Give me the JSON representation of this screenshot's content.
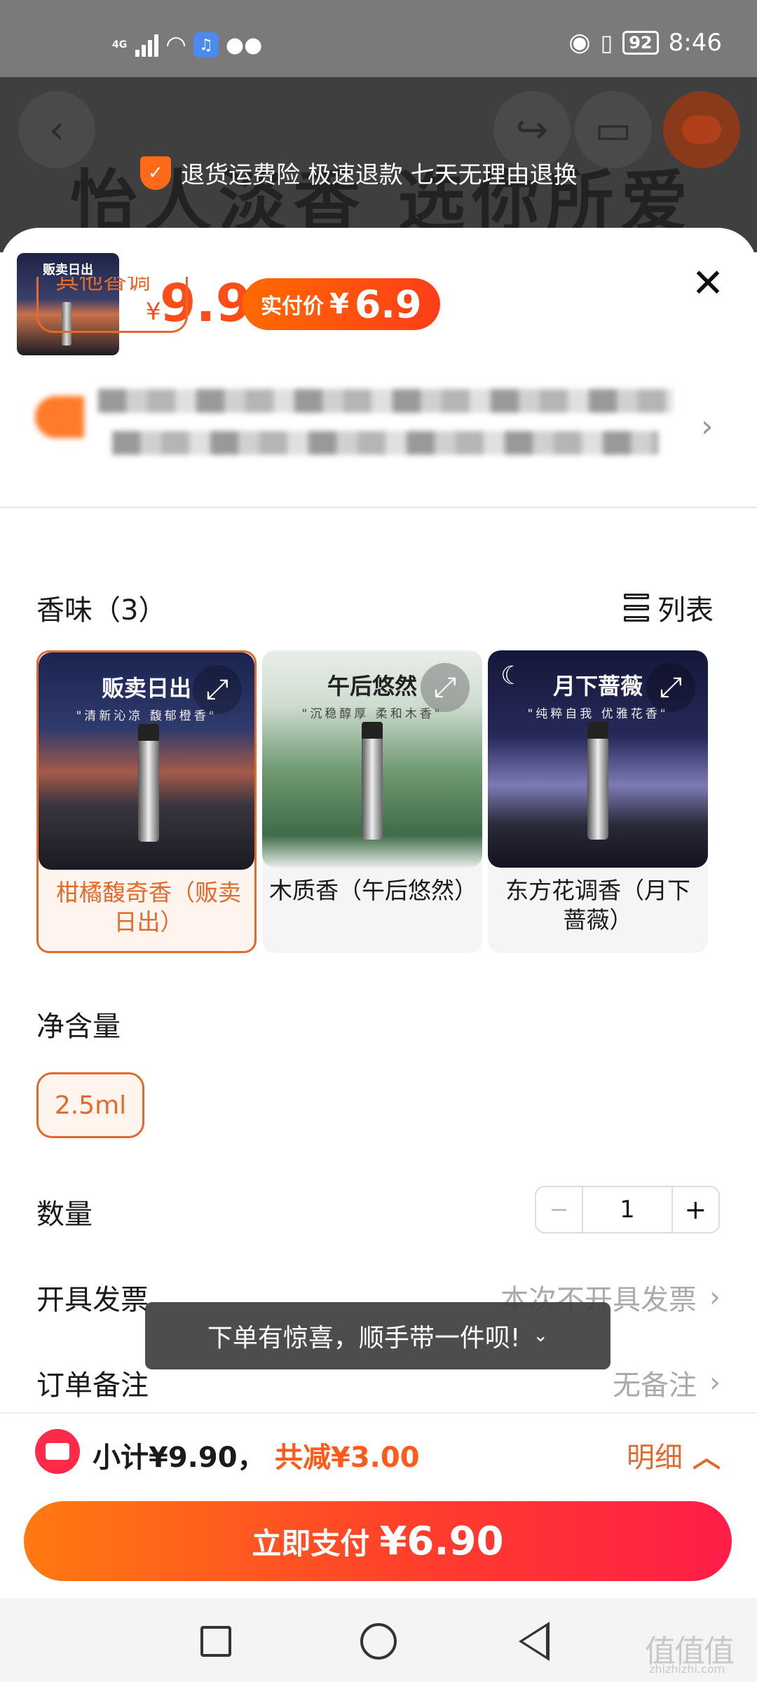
{
  "status_bar": {
    "network": "4G",
    "time": "8:46",
    "battery": "92"
  },
  "background": {
    "banner_text": "怡人淡香 选你所爱",
    "guarantee": "退货运费险 极速退款 七天无理由退换"
  },
  "product": {
    "thumb_title": "贩卖日出",
    "currency": "¥",
    "price": "9.9",
    "pay_label": "实付价",
    "pay_currency": "¥",
    "pay_price": "6.9"
  },
  "options": {
    "cut_chip": "其他香调",
    "scent_title": "香味（3）",
    "list_label": "列表",
    "scents": [
      {
        "title": "贩卖日出",
        "tagline": "\"清新沁凉 馥郁橙香\"",
        "name": "柑橘馥奇香（贩卖日出）",
        "selected": true
      },
      {
        "title": "午后悠然",
        "tagline": "\"沉稳醇厚 柔和木香\"",
        "name": "木质香（午后悠然）",
        "selected": false
      },
      {
        "title": "月下蔷薇",
        "tagline": "\"纯粹自我 优雅花香\"",
        "name": "东方花调香（月下蔷薇）",
        "selected": false
      }
    ],
    "volume_title": "净含量",
    "volume_option": "2.5ml",
    "qty_title": "数量",
    "qty_value": "1",
    "qty_minus": "−",
    "qty_plus": "+",
    "invoice_title": "开具发票",
    "invoice_value": "本次不开具发票",
    "note_title": "订单备注",
    "note_value": "无备注"
  },
  "toast": {
    "text": "下单有惊喜，顺手带一件呗!"
  },
  "footer": {
    "subtotal": "小计¥9.90，",
    "discount": "共减¥3.00",
    "detail_label": "明细",
    "pay_label": "立即支付",
    "pay_amount": "¥6.90"
  },
  "watermark": {
    "main": "值值值",
    "sub": "zhizhizhi.com"
  },
  "colors": {
    "accent": "#e26a2c",
    "price": "#ff4d1a",
    "pay_gradient_start": "#ff7a10",
    "pay_gradient_end": "#ff1d48"
  }
}
